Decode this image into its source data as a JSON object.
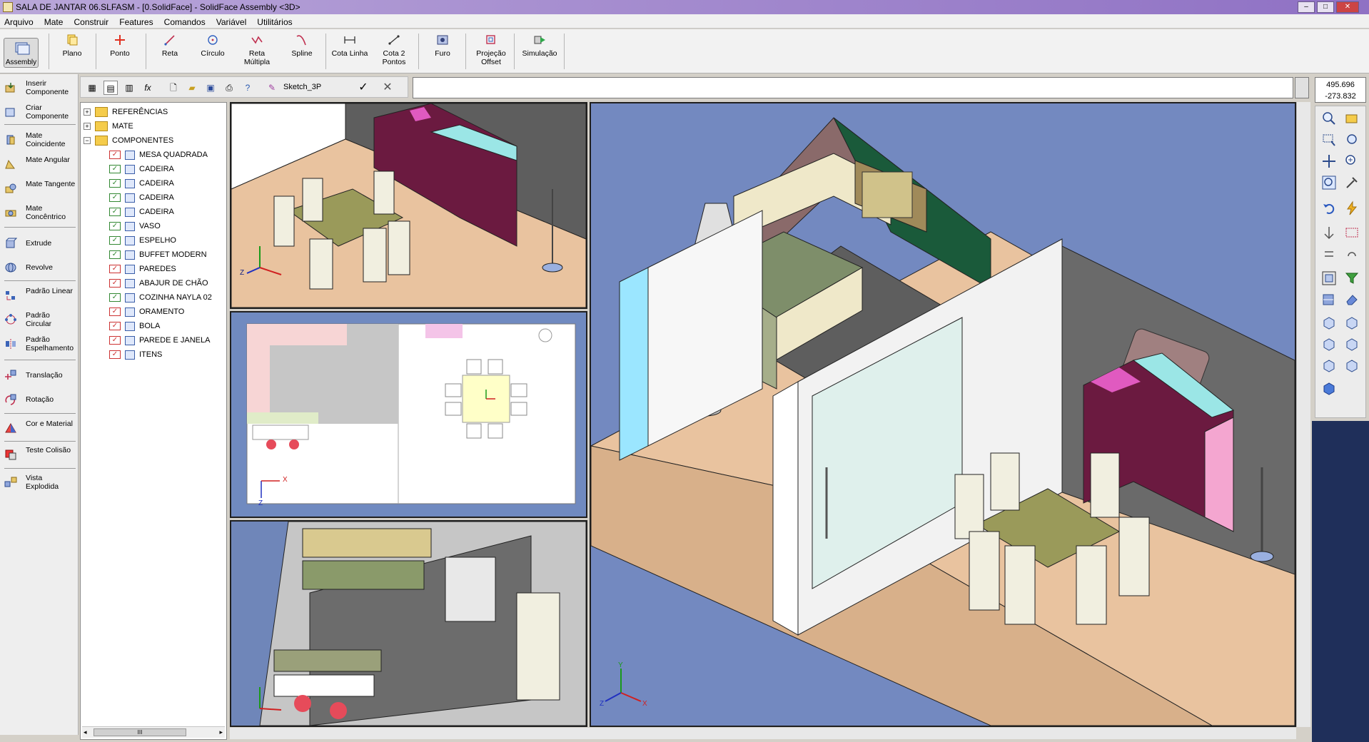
{
  "window": {
    "title": "SALA DE JANTAR 06.SLFASM - [0.SolidFace] - SolidFace Assembly <3D>",
    "minimize": "–",
    "maximize": "□",
    "close": "✕"
  },
  "menu": [
    "Arquivo",
    "Mate",
    "Construir",
    "Features",
    "Comandos",
    "Variável",
    "Utilitários"
  ],
  "ribbon": {
    "assembly": "Assembly",
    "items": [
      {
        "label": "Plano",
        "icon": "plane-icon"
      },
      {
        "label": "Ponto",
        "icon": "point-icon"
      },
      {
        "label": "Reta",
        "icon": "line-icon"
      },
      {
        "label": "Círculo",
        "icon": "circle-icon"
      },
      {
        "label": "Reta Múltipla",
        "icon": "polyline-icon"
      },
      {
        "label": "Spline",
        "icon": "spline-icon"
      },
      {
        "label": "Cota Linha",
        "icon": "dimension-line-icon"
      },
      {
        "label": "Cota 2 Pontos",
        "icon": "dimension-two-points-icon"
      },
      {
        "label": "Furo",
        "icon": "hole-icon"
      },
      {
        "label": "Projeção Offset",
        "icon": "offset-projection-icon"
      },
      {
        "label": "Simulação",
        "icon": "simulation-icon"
      }
    ]
  },
  "commands": [
    {
      "label": "Inserir Componente"
    },
    {
      "label": "Criar Componente"
    },
    {
      "label": "Mate Coincidente"
    },
    {
      "label": "Mate Angular"
    },
    {
      "label": "Mate Tangente"
    },
    {
      "label": "Mate Concêntrico"
    },
    {
      "label": "Extrude"
    },
    {
      "label": "Revolve"
    },
    {
      "label": "Padrão Linear"
    },
    {
      "label": "Padrão Circular"
    },
    {
      "label": "Padrão Espelhamento"
    },
    {
      "label": "Translação"
    },
    {
      "label": "Rotação"
    },
    {
      "label": "Cor e Material"
    },
    {
      "label": "Teste Colisão"
    },
    {
      "label": "Vista Explodida"
    }
  ],
  "sketchbar": {
    "sketch_name": "Sketch_3P"
  },
  "coords": {
    "x": "495.696",
    "y": "-273.832"
  },
  "tree": {
    "root": [
      {
        "label": "REFERÊNCIAS",
        "expander": "+"
      },
      {
        "label": "MATE",
        "expander": "+"
      },
      {
        "label": "COMPONENTES",
        "expander": "−"
      }
    ],
    "components": [
      {
        "label": "MESA QUADRADA",
        "state": "red"
      },
      {
        "label": "CADEIRA",
        "state": "green"
      },
      {
        "label": "CADEIRA",
        "state": "green"
      },
      {
        "label": "CADEIRA",
        "state": "green"
      },
      {
        "label": "CADEIRA",
        "state": "green"
      },
      {
        "label": "VASO",
        "state": "green"
      },
      {
        "label": "ESPELHO",
        "state": "green"
      },
      {
        "label": "BUFFET MODERN",
        "state": "green"
      },
      {
        "label": "PAREDES",
        "state": "red"
      },
      {
        "label": "ABAJUR DE CHÃO",
        "state": "red"
      },
      {
        "label": "COZINHA NAYLA 02",
        "state": "green"
      },
      {
        "label": "ORAMENTO",
        "state": "red"
      },
      {
        "label": "BOLA",
        "state": "red"
      },
      {
        "label": "PAREDE E JANELA",
        "state": "red"
      },
      {
        "label": "ITENS",
        "state": "red"
      }
    ],
    "scroll_thumb": "III"
  },
  "axes": {
    "x": "X",
    "y": "Y",
    "z": "Z"
  },
  "colors": {
    "viewport_bg": "#7389c0",
    "floor": "#e9c39f",
    "wall_gray": "#6a6a6a",
    "cabinet": "#6b1a40",
    "counter_teal": "#9be6e6",
    "chair": "#f1efe0",
    "table": "#9a9a5a"
  }
}
